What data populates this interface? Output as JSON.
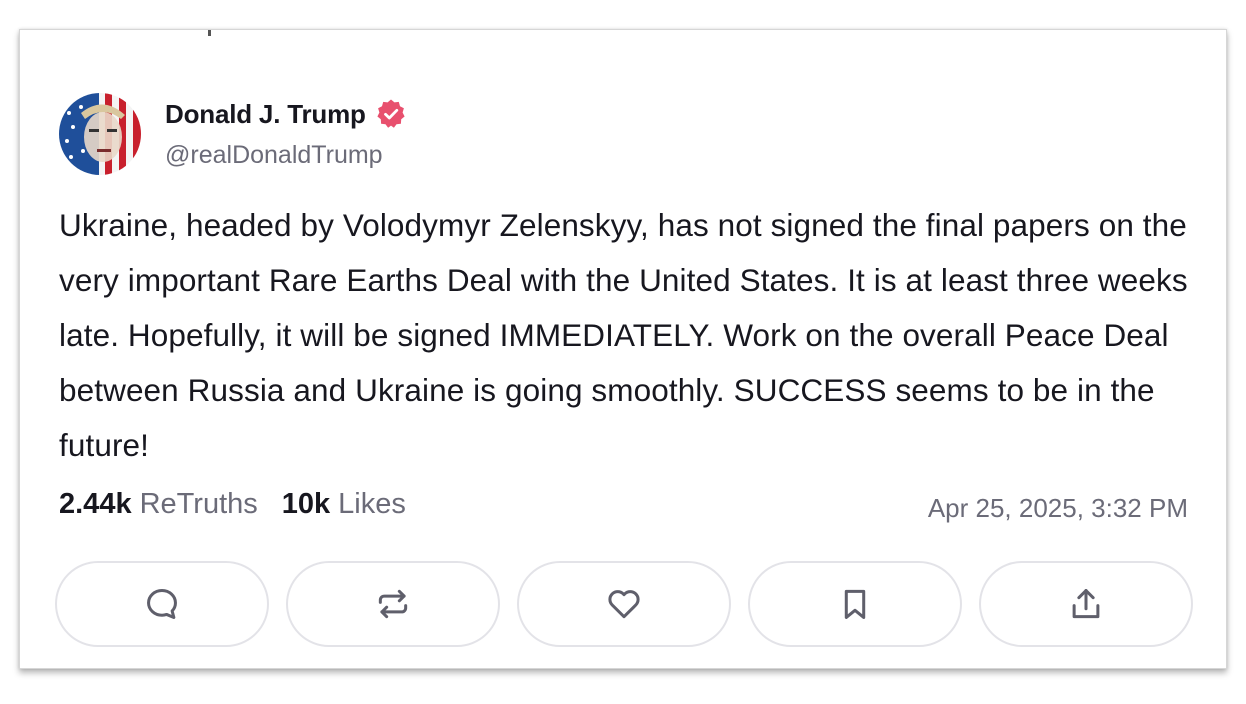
{
  "post": {
    "author": {
      "display_name": "Donald J. Trump",
      "handle": "@realDonaldTrump",
      "verified": true,
      "verified_color": "#e8506e",
      "avatar_icon": "avatar-image"
    },
    "text": "Ukraine, headed by Volodymyr Zelenskyy, has not signed the final papers on the very important Rare Earths Deal with the United States. It is at least three weeks late. Hopefully, it will be signed IMMEDIATELY. Work on the overall Peace Deal between Russia and Ukraine is going smoothly. SUCCESS seems to be in the future!",
    "stats": {
      "retruths_count": "2.44k",
      "retruths_label": "ReTruths",
      "likes_count": "10k",
      "likes_label": "Likes"
    },
    "timestamp": "Apr 25, 2025, 3:32 PM"
  },
  "actions": [
    {
      "name": "reply-button",
      "icon": "comment-icon"
    },
    {
      "name": "retruth-button",
      "icon": "repost-icon"
    },
    {
      "name": "like-button",
      "icon": "heart-icon"
    },
    {
      "name": "bookmark-button",
      "icon": "bookmark-icon"
    },
    {
      "name": "share-button",
      "icon": "share-icon"
    }
  ],
  "colors": {
    "text_primary": "#17171f",
    "text_secondary": "#6b6b78",
    "button_border": "#e3e3e8",
    "icon_color": "#5f5f6b"
  }
}
